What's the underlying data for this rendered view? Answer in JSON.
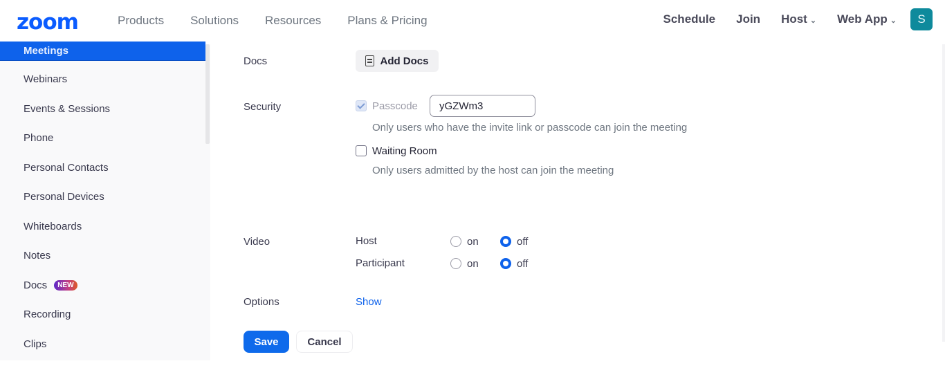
{
  "header": {
    "logo": "zoom",
    "nav_left": [
      "Products",
      "Solutions",
      "Resources",
      "Plans & Pricing"
    ],
    "nav_right": {
      "schedule": "Schedule",
      "join": "Join",
      "host": "Host",
      "web_app": "Web App",
      "avatar_initial": "S"
    }
  },
  "sidebar": {
    "items": [
      {
        "label": "Meetings",
        "active": true
      },
      {
        "label": "Webinars"
      },
      {
        "label": "Events & Sessions"
      },
      {
        "label": "Phone"
      },
      {
        "label": "Personal Contacts"
      },
      {
        "label": "Personal Devices"
      },
      {
        "label": "Whiteboards"
      },
      {
        "label": "Notes"
      },
      {
        "label": "Docs",
        "badge": "NEW"
      },
      {
        "label": "Recording"
      },
      {
        "label": "Clips"
      }
    ]
  },
  "form": {
    "docs": {
      "label": "Docs",
      "button": "Add Docs"
    },
    "security": {
      "label": "Security",
      "passcode": {
        "label": "Passcode",
        "checked": true,
        "value": "yGZWm3",
        "hint": "Only users who have the invite link or passcode can join the meeting"
      },
      "waiting_room": {
        "label": "Waiting Room",
        "checked": false,
        "hint": "Only users admitted by the host can join the meeting"
      }
    },
    "video": {
      "label": "Video",
      "host": {
        "label": "Host",
        "on": "on",
        "off": "off",
        "selected": "off"
      },
      "participant": {
        "label": "Participant",
        "on": "on",
        "off": "off",
        "selected": "off"
      }
    },
    "options": {
      "label": "Options",
      "link": "Show"
    },
    "actions": {
      "save": "Save",
      "cancel": "Cancel"
    }
  },
  "colors": {
    "brand": "#0b5cff",
    "accent": "#0e62eb",
    "avatar": "#0e8a9c"
  }
}
